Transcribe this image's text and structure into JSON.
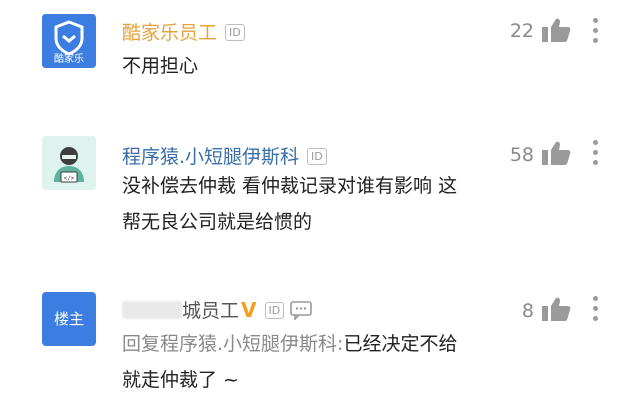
{
  "comments": [
    {
      "name": "酷家乐员工",
      "id_badge": "ID",
      "likes": "22",
      "text": "不用担心",
      "avatar_label": "酷家乐"
    },
    {
      "name": "程序猿.小短腿伊斯科",
      "id_badge": "ID",
      "likes": "58",
      "text_line1": "没补偿去仲裁 看仲裁记录对谁有影响 这",
      "text_line2": "帮无良公司就是给惯的"
    },
    {
      "name_suffix": "城员工",
      "v_badge": "V",
      "id_badge": "ID",
      "likes": "8",
      "avatar_label": "楼主",
      "reply_prefix": "回复程序猿.小短腿伊斯科:",
      "text_line1_rest": "已经决定不给",
      "text_line2": "就走仲裁了 ~"
    }
  ],
  "colors": {
    "accent_blue": "#3a7bd5",
    "name_gold": "#e6a23c",
    "name_blue": "#3a6ea8",
    "text": "#222222",
    "muted": "#8a8a8a"
  },
  "icons": [
    "verified-shield-icon",
    "coder-avatar-icon",
    "thumb-up-icon",
    "more-vertical-icon",
    "comment-icon"
  ]
}
